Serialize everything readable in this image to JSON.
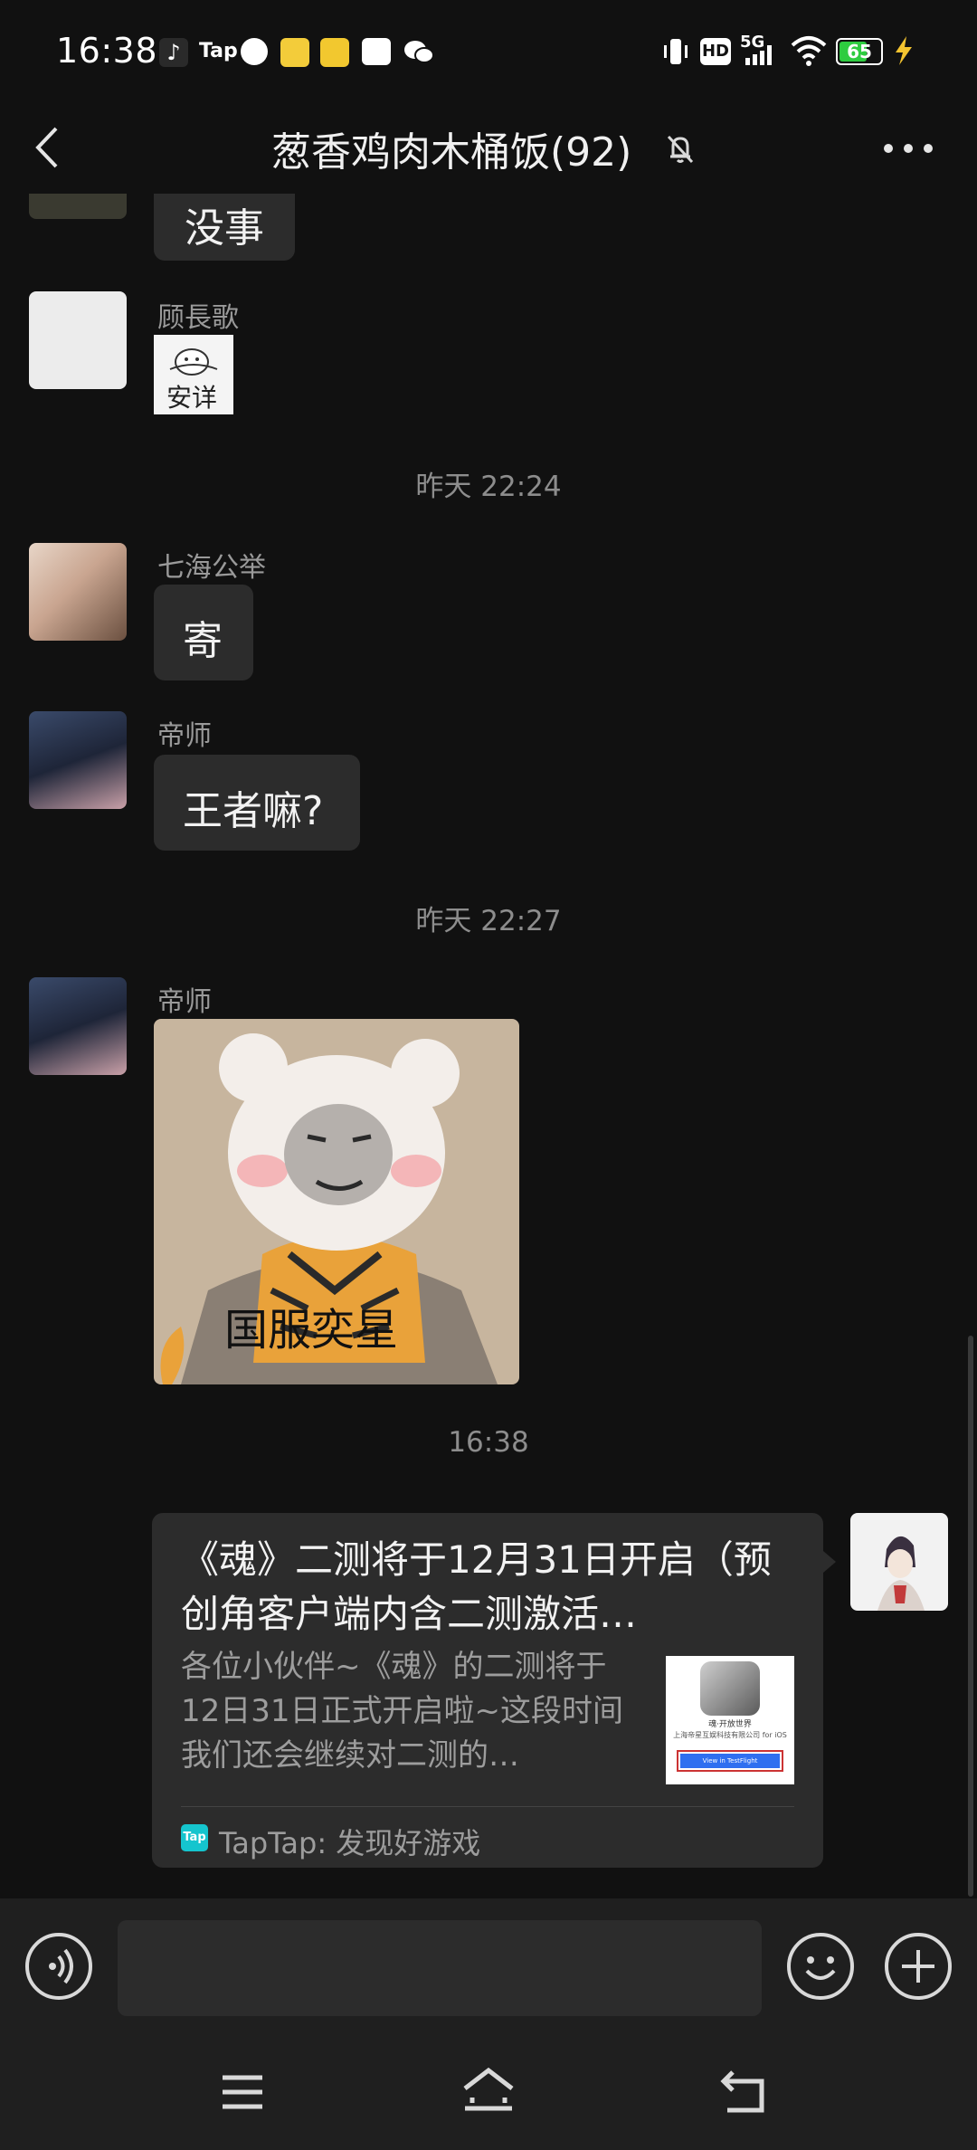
{
  "status_bar": {
    "time": "16:38",
    "battery": "65",
    "network": "5G",
    "hd_badge": "HD",
    "app_icons": [
      "tiktok-icon",
      "tap-icon",
      "speedometer-icon",
      "manga-app-icon",
      "qq-browser-icon",
      "message-icon",
      "wechat-icon"
    ]
  },
  "header": {
    "title": "葱香鸡肉木桶饭(92)"
  },
  "messages": {
    "partial_text": "没事",
    "m1": {
      "sender": "顾長歌",
      "sticker_text": "安详"
    },
    "ts1": "昨天 22:24",
    "m2": {
      "sender": "七海公举",
      "text": "寄"
    },
    "m3": {
      "sender": "帝师",
      "text": "王者嘛?"
    },
    "ts2": "昨天 22:27",
    "m4": {
      "sender": "帝师",
      "sticker_text": "国服奕星"
    },
    "ts3": "16:38",
    "card": {
      "title": "《魂》二测将于12月31日开启（预创角客户端内含二测激活…",
      "description": "各位小伙伴~《魂》的二测将于12日31日正式开启啦~这段时间我们还会继续对二测的…",
      "source": "TapTap: 发现好游戏",
      "source_icon": "Tap",
      "thumb_line1": "魂·开放世界",
      "thumb_line2": "上海帝星互娱科技有限公司 for iOS",
      "thumb_button": "View in TestFlight"
    }
  },
  "colors": {
    "background": "#111111",
    "bubble": "#2c2c2c",
    "taptap": "#15c5ce"
  }
}
